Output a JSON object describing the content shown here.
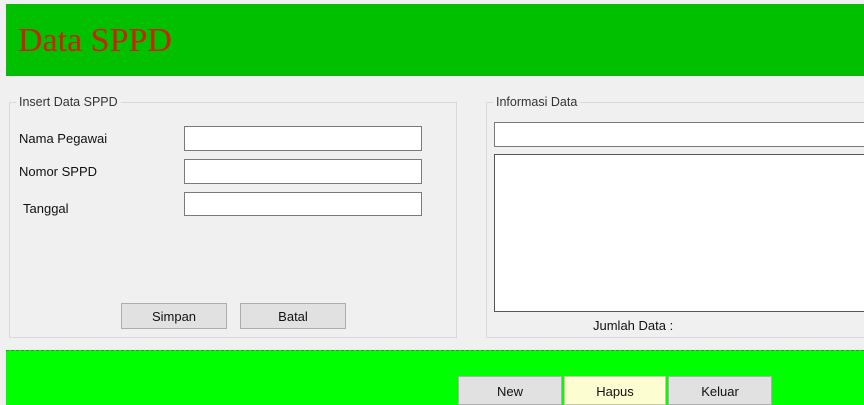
{
  "header": {
    "title": "Data SPPD"
  },
  "insert_group": {
    "legend": "Insert Data SPPD",
    "fields": [
      {
        "label": "Nama Pegawai",
        "value": ""
      },
      {
        "label": "Nomor SPPD",
        "value": ""
      },
      {
        "label": "Tanggal",
        "value": ""
      }
    ],
    "buttons": {
      "save": "Simpan",
      "cancel": "Batal"
    }
  },
  "info_group": {
    "legend": "Informasi Data",
    "search_value": "",
    "list_items": [],
    "count_label": "Jumlah Data :",
    "count_value": ""
  },
  "footer": {
    "buttons": {
      "new": "New",
      "delete": "Hapus",
      "exit": "Keluar"
    }
  },
  "colors": {
    "header_bg": "#00c000",
    "title": "#cc2200",
    "footer_bg": "#00ff00"
  }
}
